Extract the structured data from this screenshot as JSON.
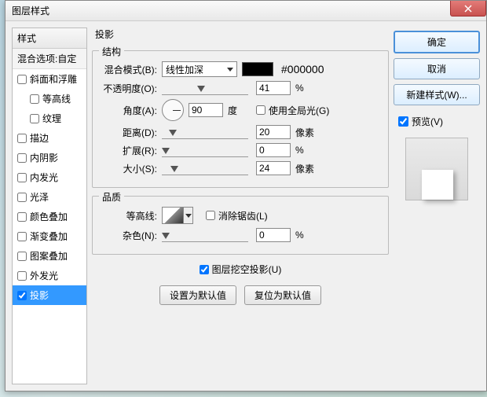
{
  "title": "图层样式",
  "left": {
    "header": "样式",
    "sub": "混合选项:自定",
    "items": [
      {
        "label": "斜面和浮雕",
        "checked": false,
        "indent": false
      },
      {
        "label": "等高线",
        "checked": false,
        "indent": true
      },
      {
        "label": "纹理",
        "checked": false,
        "indent": true
      },
      {
        "label": "描边",
        "checked": false,
        "indent": false
      },
      {
        "label": "内阴影",
        "checked": false,
        "indent": false
      },
      {
        "label": "内发光",
        "checked": false,
        "indent": false
      },
      {
        "label": "光泽",
        "checked": false,
        "indent": false
      },
      {
        "label": "颜色叠加",
        "checked": false,
        "indent": false
      },
      {
        "label": "渐变叠加",
        "checked": false,
        "indent": false
      },
      {
        "label": "图案叠加",
        "checked": false,
        "indent": false
      },
      {
        "label": "外发光",
        "checked": false,
        "indent": false
      },
      {
        "label": "投影",
        "checked": true,
        "indent": false,
        "selected": true
      }
    ]
  },
  "center": {
    "panel_title": "投影",
    "structure": {
      "legend": "结构",
      "blend_label": "混合模式(B):",
      "blend_value": "线性加深",
      "hex": "#000000",
      "opacity_label": "不透明度(O):",
      "opacity_value": "41",
      "opacity_unit": "%",
      "angle_label": "角度(A):",
      "angle_value": "90",
      "angle_unit": "度",
      "global_label": "使用全局光(G)",
      "distance_label": "距离(D):",
      "distance_value": "20",
      "distance_unit": "像素",
      "spread_label": "扩展(R):",
      "spread_value": "0",
      "spread_unit": "%",
      "size_label": "大小(S):",
      "size_value": "24",
      "size_unit": "像素"
    },
    "quality": {
      "legend": "品质",
      "contour_label": "等高线:",
      "antialias_label": "消除锯齿(L)",
      "noise_label": "杂色(N):",
      "noise_value": "0",
      "noise_unit": "%"
    },
    "knockout_label": "图层挖空投影(U)",
    "btn_default": "设置为默认值",
    "btn_reset": "复位为默认值"
  },
  "right": {
    "ok": "确定",
    "cancel": "取消",
    "newstyle": "新建样式(W)...",
    "preview": "预览(V)"
  }
}
